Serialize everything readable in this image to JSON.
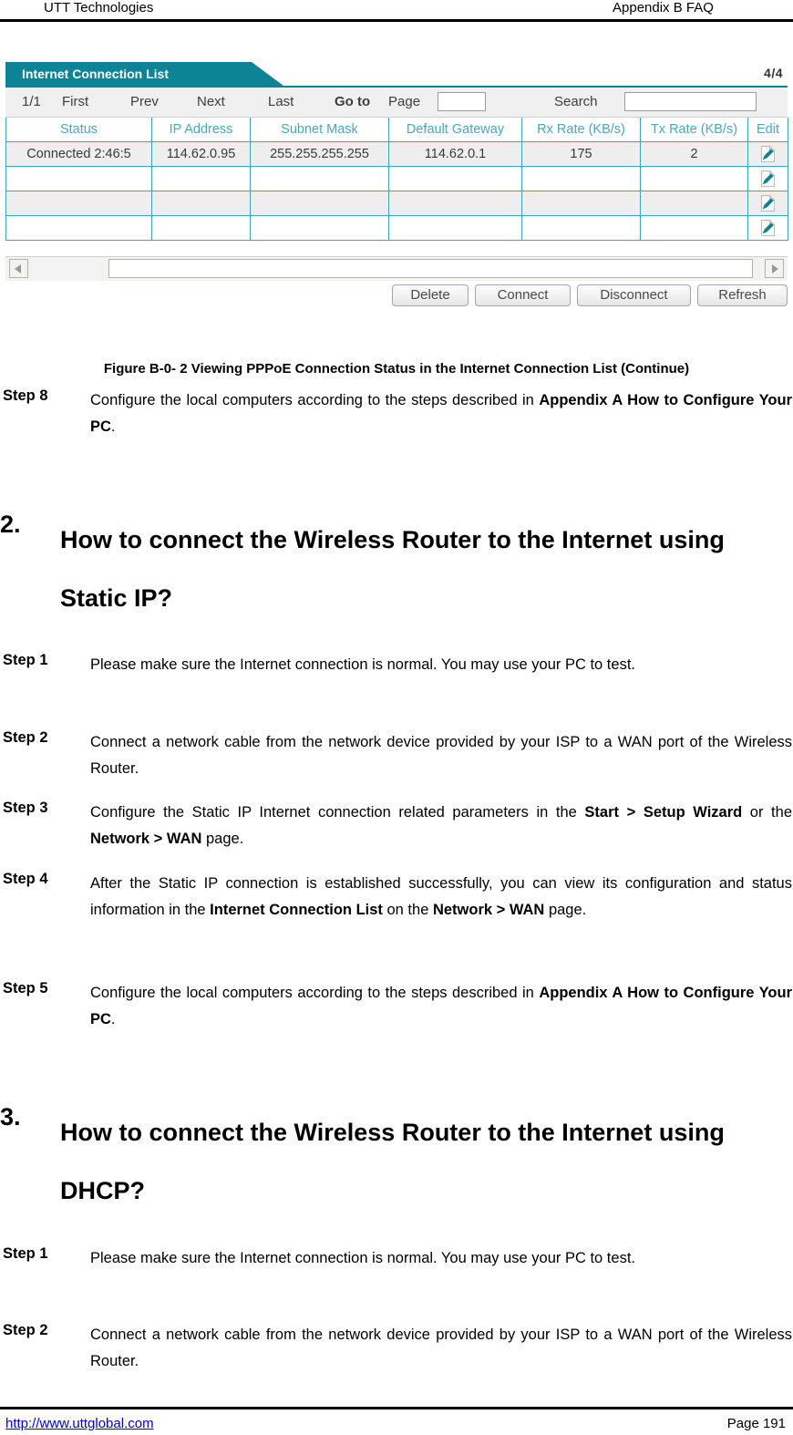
{
  "header": {
    "left": "UTT Technologies",
    "right": "Appendix B FAQ"
  },
  "ui": {
    "tab_title": "Internet Connection List",
    "counter": "4/4",
    "pager": {
      "page_indicator": "1/1",
      "first": "First",
      "prev": "Prev",
      "next": "Next",
      "last": "Last",
      "goto": "Go to",
      "page": "Page",
      "page_value": "",
      "search": "Search",
      "search_value": ""
    },
    "columns": [
      "Status",
      "IP Address",
      "Subnet Mask",
      "Default Gateway",
      "Rx Rate (KB/s)",
      "Tx Rate (KB/s)",
      "Edit"
    ],
    "rows": [
      {
        "status": "Connected 2:46:5",
        "ip": "114.62.0.95",
        "mask": "255.255.255.255",
        "gateway": "114.62.0.1",
        "rx": "175",
        "tx": "2"
      },
      {
        "status": "",
        "ip": "",
        "mask": "",
        "gateway": "",
        "rx": "",
        "tx": ""
      },
      {
        "status": "",
        "ip": "",
        "mask": "",
        "gateway": "",
        "rx": "",
        "tx": ""
      },
      {
        "status": "",
        "ip": "",
        "mask": "",
        "gateway": "",
        "rx": "",
        "tx": ""
      }
    ],
    "buttons": {
      "delete": "Delete",
      "connect": "Connect",
      "disconnect": "Disconnect",
      "refresh": "Refresh"
    },
    "colors": {
      "accent": "#0d8496",
      "grid": "#3da7b4",
      "header_text": "#4aa8b8"
    }
  },
  "figure_caption": "Figure B-0- 2 Viewing PPPoE Connection Status in the Internet Connection List (Continue)",
  "step8": {
    "label": "Step 8",
    "text_1": "Configure the local computers according to the steps described in ",
    "bold_1": "Appendix A How to Configure Your PC",
    "text_2": "."
  },
  "section2": {
    "number": "2.",
    "title": "How to connect the Wireless Router to the Internet using Static IP?",
    "steps": [
      {
        "label": "Step 1",
        "text_1": "Please make sure the Internet connection is normal. You may use your PC to test.",
        "bold_1": "",
        "text_2": ""
      },
      {
        "label": "Step 2",
        "text_1": "Connect a network cable from the network device provided by your ISP to a WAN port of the Wireless Router.",
        "bold_1": "",
        "text_2": ""
      },
      {
        "label": "Step 3",
        "text_1": "Configure the Static IP Internet connection related parameters in the ",
        "bold_1": "Start > Setup Wizard",
        "text_2": " or the ",
        "bold_2": "Network > WAN",
        "text_3": " page."
      },
      {
        "label": "Step 4",
        "text_1": "After the Static IP connection is established successfully, you can view its configuration and status information in the ",
        "bold_1": "Internet Connection List",
        "text_2": " on the ",
        "bold_2": "Network > WAN",
        "text_3": " page."
      },
      {
        "label": "Step 5",
        "text_1": "Configure the local computers according to the steps described in ",
        "bold_1": "Appendix A How to Configure Your PC",
        "text_2": "."
      }
    ]
  },
  "section3": {
    "number": "3.",
    "title": "How to connect the Wireless Router to the Internet using DHCP?",
    "steps": [
      {
        "label": "Step 1",
        "text_1": "Please make sure the Internet connection is normal. You may use your PC to test."
      },
      {
        "label": "Step 2",
        "text_1": "Connect a network cable from the network device provided by your ISP to a WAN port of the Wireless Router."
      }
    ]
  },
  "footer": {
    "url": "http://www.uttglobal.com",
    "page": "Page 191"
  }
}
